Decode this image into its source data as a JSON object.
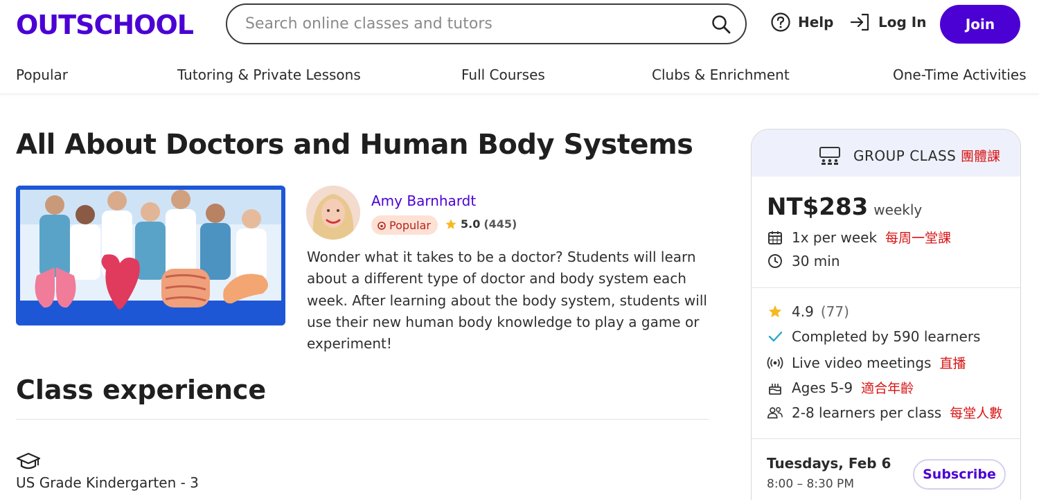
{
  "header": {
    "logo": "OUTSCHOOL",
    "search_placeholder": "Search online classes and tutors",
    "help_label": "Help",
    "login_label": "Log In",
    "join_label": "Join",
    "brand_color": "#4b01d4"
  },
  "nav": {
    "items": [
      {
        "label": "Popular"
      },
      {
        "label": "Tutoring & Private Lessons"
      },
      {
        "label": "Full Courses"
      },
      {
        "label": "Clubs & Enrichment"
      },
      {
        "label": "One-Time Activities"
      }
    ]
  },
  "main": {
    "title": "All About Doctors and Human Body Systems",
    "teacher_name": "Amy Barnhardt",
    "popular_badge": "Popular",
    "rating": "5.0",
    "rating_count": "(445)",
    "description": "Wonder what it takes to be a doctor? Students will learn about a different type of doctor and body system each week. After learning about the body system, students will use their new human body knowledge to play a game or experiment!",
    "section_title": "Class experience",
    "grade": "US Grade Kindergarten - 3"
  },
  "card": {
    "type_label": "GROUP CLASS",
    "type_note": "團體課",
    "price": "NT$283",
    "price_period": "weekly",
    "frequency": "1x per week",
    "frequency_note": "每周一堂課",
    "duration": "30 min",
    "rating": "4.9",
    "rating_count": "(77)",
    "completed": "Completed by 590 learners",
    "meetings": "Live video meetings",
    "meetings_note": "直播",
    "ages": "Ages 5-9",
    "ages_note": "適合年齡",
    "class_size": "2-8 learners per class",
    "class_size_note": "每堂人數",
    "session_day": "Tuesdays, Feb 6",
    "session_time": "8:00 – 8:30 PM",
    "subscribe_label": "Subscribe"
  }
}
